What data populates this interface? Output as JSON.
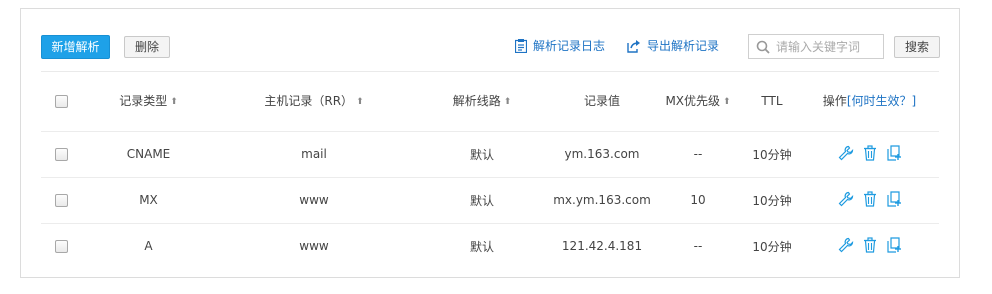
{
  "toolbar": {
    "add_label": "新增解析",
    "delete_label": "删除",
    "log_label": "解析记录日志",
    "export_label": "导出解析记录",
    "search_placeholder": "请输入关键字词",
    "search_label": "搜索"
  },
  "table": {
    "headers": {
      "type": "记录类型",
      "host": "主机记录（RR）",
      "line": "解析线路",
      "value": "记录值",
      "mx": "MX优先级",
      "ttl": "TTL",
      "ops": "操作",
      "ops_help": "[何时生效？]"
    },
    "rows": [
      {
        "type": "CNAME",
        "host": "mail",
        "line": "默认",
        "value": "ym.163.com",
        "mx": "--",
        "ttl": "10分钟"
      },
      {
        "type": "MX",
        "host": "www",
        "line": "默认",
        "value": "mx.ym.163.com",
        "mx": "10",
        "ttl": "10分钟"
      },
      {
        "type": "A",
        "host": "www",
        "line": "默认",
        "value": "121.42.4.181",
        "mx": "--",
        "ttl": "10分钟"
      }
    ]
  },
  "icons": {
    "accent": "#1e9be0",
    "edit": "wrench-icon",
    "delete": "trash-icon",
    "copy": "add-copy-icon"
  }
}
